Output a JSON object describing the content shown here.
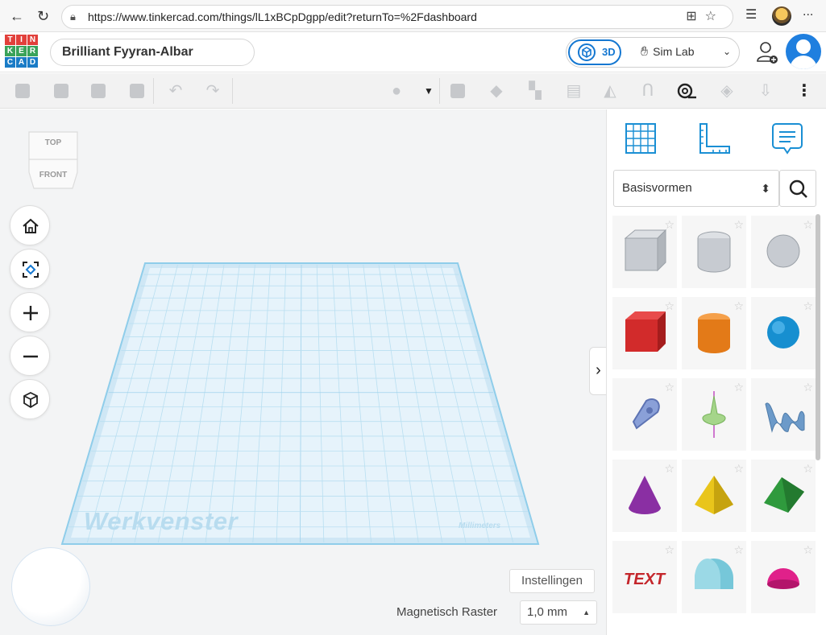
{
  "browser": {
    "url": "https://www.tinkercad.com/things/lL1xBCpDgpp/edit?returnTo=%2Fdashboard",
    "back_icon": "arrow-left-icon",
    "reload_icon": "reload-icon",
    "more_label": "..."
  },
  "header": {
    "logo_letters": [
      "T",
      "I",
      "N",
      "K",
      "E",
      "R",
      "C",
      "A",
      "D"
    ],
    "logo_colors": [
      "#e2403b",
      "#e2403b",
      "#e2403b",
      "#3aa35a",
      "#3aa35a",
      "#3aa35a",
      "#1a7cc7",
      "#1a7cc7",
      "#1a7cc7"
    ],
    "project_name": "Brilliant Fyyran-Albar",
    "mode_3d_label": "3D",
    "sim_lab_label": "Sim Lab",
    "accent": "#1477d1"
  },
  "viewcube": {
    "top_label": "TOP",
    "front_label": "FRONT"
  },
  "workplane": {
    "title": "Werkvenster",
    "units": "Millimeters"
  },
  "footer": {
    "settings_label": "Instellingen",
    "snap_label": "Magnetisch Raster",
    "snap_value": "1,0 mm"
  },
  "panel": {
    "category": "Basisvormen",
    "shapes": [
      "Kubus (vulling)",
      "Cilinder (vulling)",
      "Bol (vulling)",
      "Kubus",
      "Cilinder",
      "Bol",
      "Krabbel",
      "Tol",
      "Gewonden tekst",
      "Kegel",
      "Piramide",
      "Dak",
      "Tekst",
      "Halve cilinder",
      "Halve bol"
    ]
  }
}
